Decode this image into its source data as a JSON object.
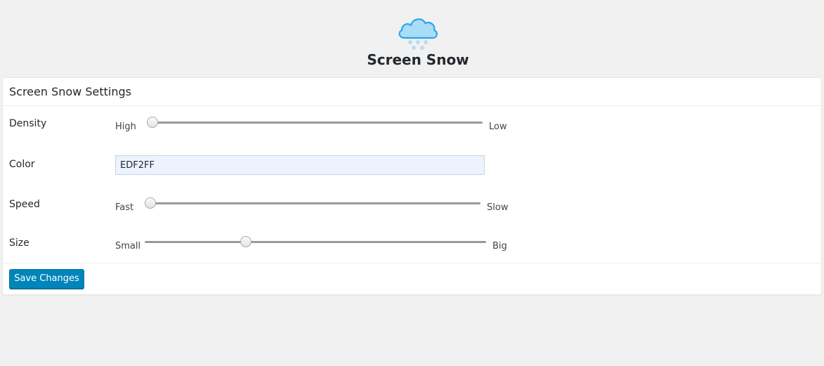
{
  "app": {
    "title": "Screen Snow",
    "logo_icon": "snow-cloud-icon"
  },
  "panel": {
    "heading": "Screen Snow Settings",
    "density": {
      "label": "Density",
      "min_label": "High",
      "max_label": "Low",
      "value_fraction": 0.0
    },
    "color": {
      "label": "Color",
      "value": "EDF2FF"
    },
    "speed": {
      "label": "Speed",
      "min_label": "Fast",
      "max_label": "Slow",
      "value_fraction": 0.0
    },
    "size": {
      "label": "Size",
      "min_label": "Small",
      "max_label": "Big",
      "value_fraction": 0.29
    },
    "save_label": "Save Changes"
  },
  "colors": {
    "background": "#f1f1f1",
    "button": "#0085ba",
    "color_field": "#edf2ff",
    "cloud": "#a9dcf7"
  }
}
